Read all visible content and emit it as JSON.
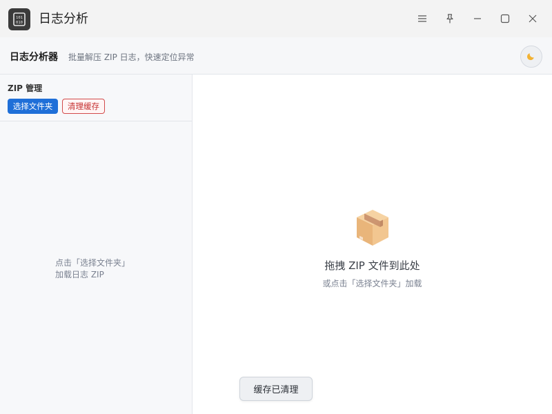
{
  "window": {
    "title": "日志分析",
    "icon": "binary-file-icon",
    "controls": [
      "menu-icon",
      "pin-icon",
      "minimize-icon",
      "maximize-icon",
      "close-icon"
    ]
  },
  "header": {
    "title": "日志分析器",
    "subtitle": "批量解压 ZIP 日志，快速定位异常",
    "theme_toggle_icon": "moon-icon"
  },
  "sidebar": {
    "section_label": "ZIP 管理",
    "select_folder_label": "选择文件夹",
    "clear_cache_label": "清理缓存",
    "empty_line1": "点击「选择文件夹」",
    "empty_line2": "加载日志 ZIP"
  },
  "main": {
    "drop_icon": "package-icon",
    "drop_title": "拖拽 ZIP 文件到此处",
    "drop_subtitle": "或点击「选择文件夹」加载"
  },
  "toast": {
    "message": "缓存已清理"
  },
  "colors": {
    "accent": "#1f6fd8",
    "danger": "#c53030",
    "titlebar_bg": "#f3f3f3"
  }
}
